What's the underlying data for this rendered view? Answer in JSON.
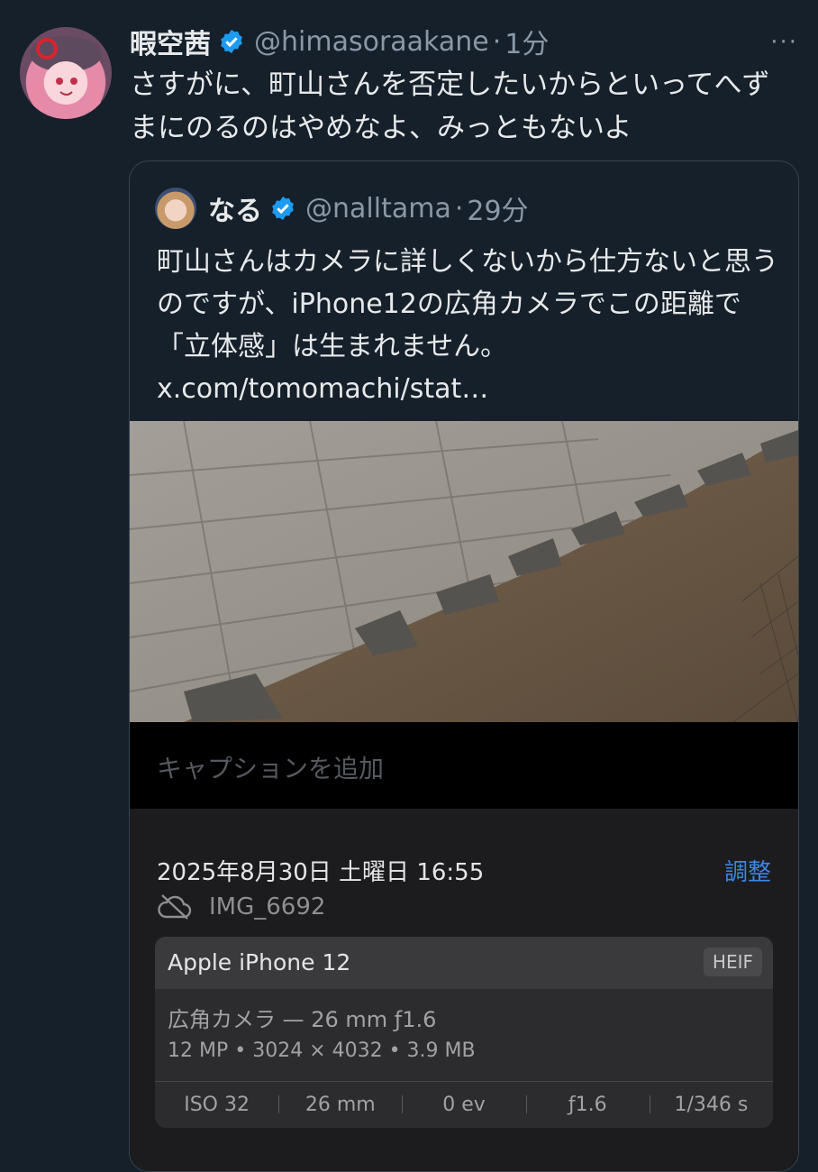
{
  "tweet": {
    "author_name": "暇空茜",
    "handle": "@himasoraakane",
    "separator": "·",
    "time": "1分",
    "more": "···",
    "text": "さすがに、町山さんを否定したいからといってへずまにのるのはやめなよ、みっともないよ"
  },
  "quote": {
    "author_name": "なる",
    "handle": "@nalltama",
    "separator": "·",
    "time": "29分",
    "text": "町山さんはカメラに詳しくないから仕方ないと思うのですが、iPhone12の広角カメラでこの距離で「立体感」は生まれません。 x.com/tomomachi/stat…"
  },
  "photo_info": {
    "caption_placeholder": "キャプションを追加",
    "date": "2025年8月30日 土曜日 16:55",
    "adjust_label": "調整",
    "filename": "IMG_6692",
    "device": "Apple iPhone 12",
    "format": "HEIF",
    "lens": "広角カメラ — 26 mm ƒ1.6",
    "specs": "12 MP • 3024 × 4032 • 3.9 MB",
    "exif": [
      "ISO 32",
      "26 mm",
      "0 ev",
      "ƒ1.6",
      "1/346 s"
    ]
  },
  "colors": {
    "background": "#15202b",
    "verified_blue": "#1d9bf0",
    "link_blue": "#3a87e8"
  }
}
